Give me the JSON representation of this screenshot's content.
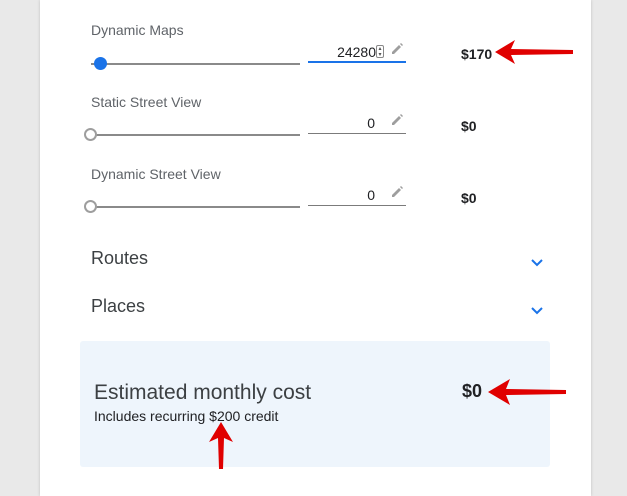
{
  "services": [
    {
      "label": "Dynamic Maps",
      "value": "24280",
      "price": "$170",
      "slider_fraction": 0.04
    },
    {
      "label": "Static Street View",
      "value": "0",
      "price": "$0",
      "slider_fraction": 0
    },
    {
      "label": "Dynamic Street View",
      "value": "0",
      "price": "$0",
      "slider_fraction": 0
    }
  ],
  "sections": [
    {
      "title": "Routes"
    },
    {
      "title": "Places"
    }
  ],
  "estimate": {
    "title": "Estimated monthly cost",
    "subtitle": "Includes recurring $200 credit",
    "price": "$0"
  },
  "colors": {
    "accent": "#1a73e8",
    "annotation_arrow": "#e00000",
    "estimate_background": "#eef5fc"
  },
  "icons": {
    "edit": "pencil-icon",
    "expand": "chevron-down-icon",
    "annotation": "red-arrow"
  }
}
